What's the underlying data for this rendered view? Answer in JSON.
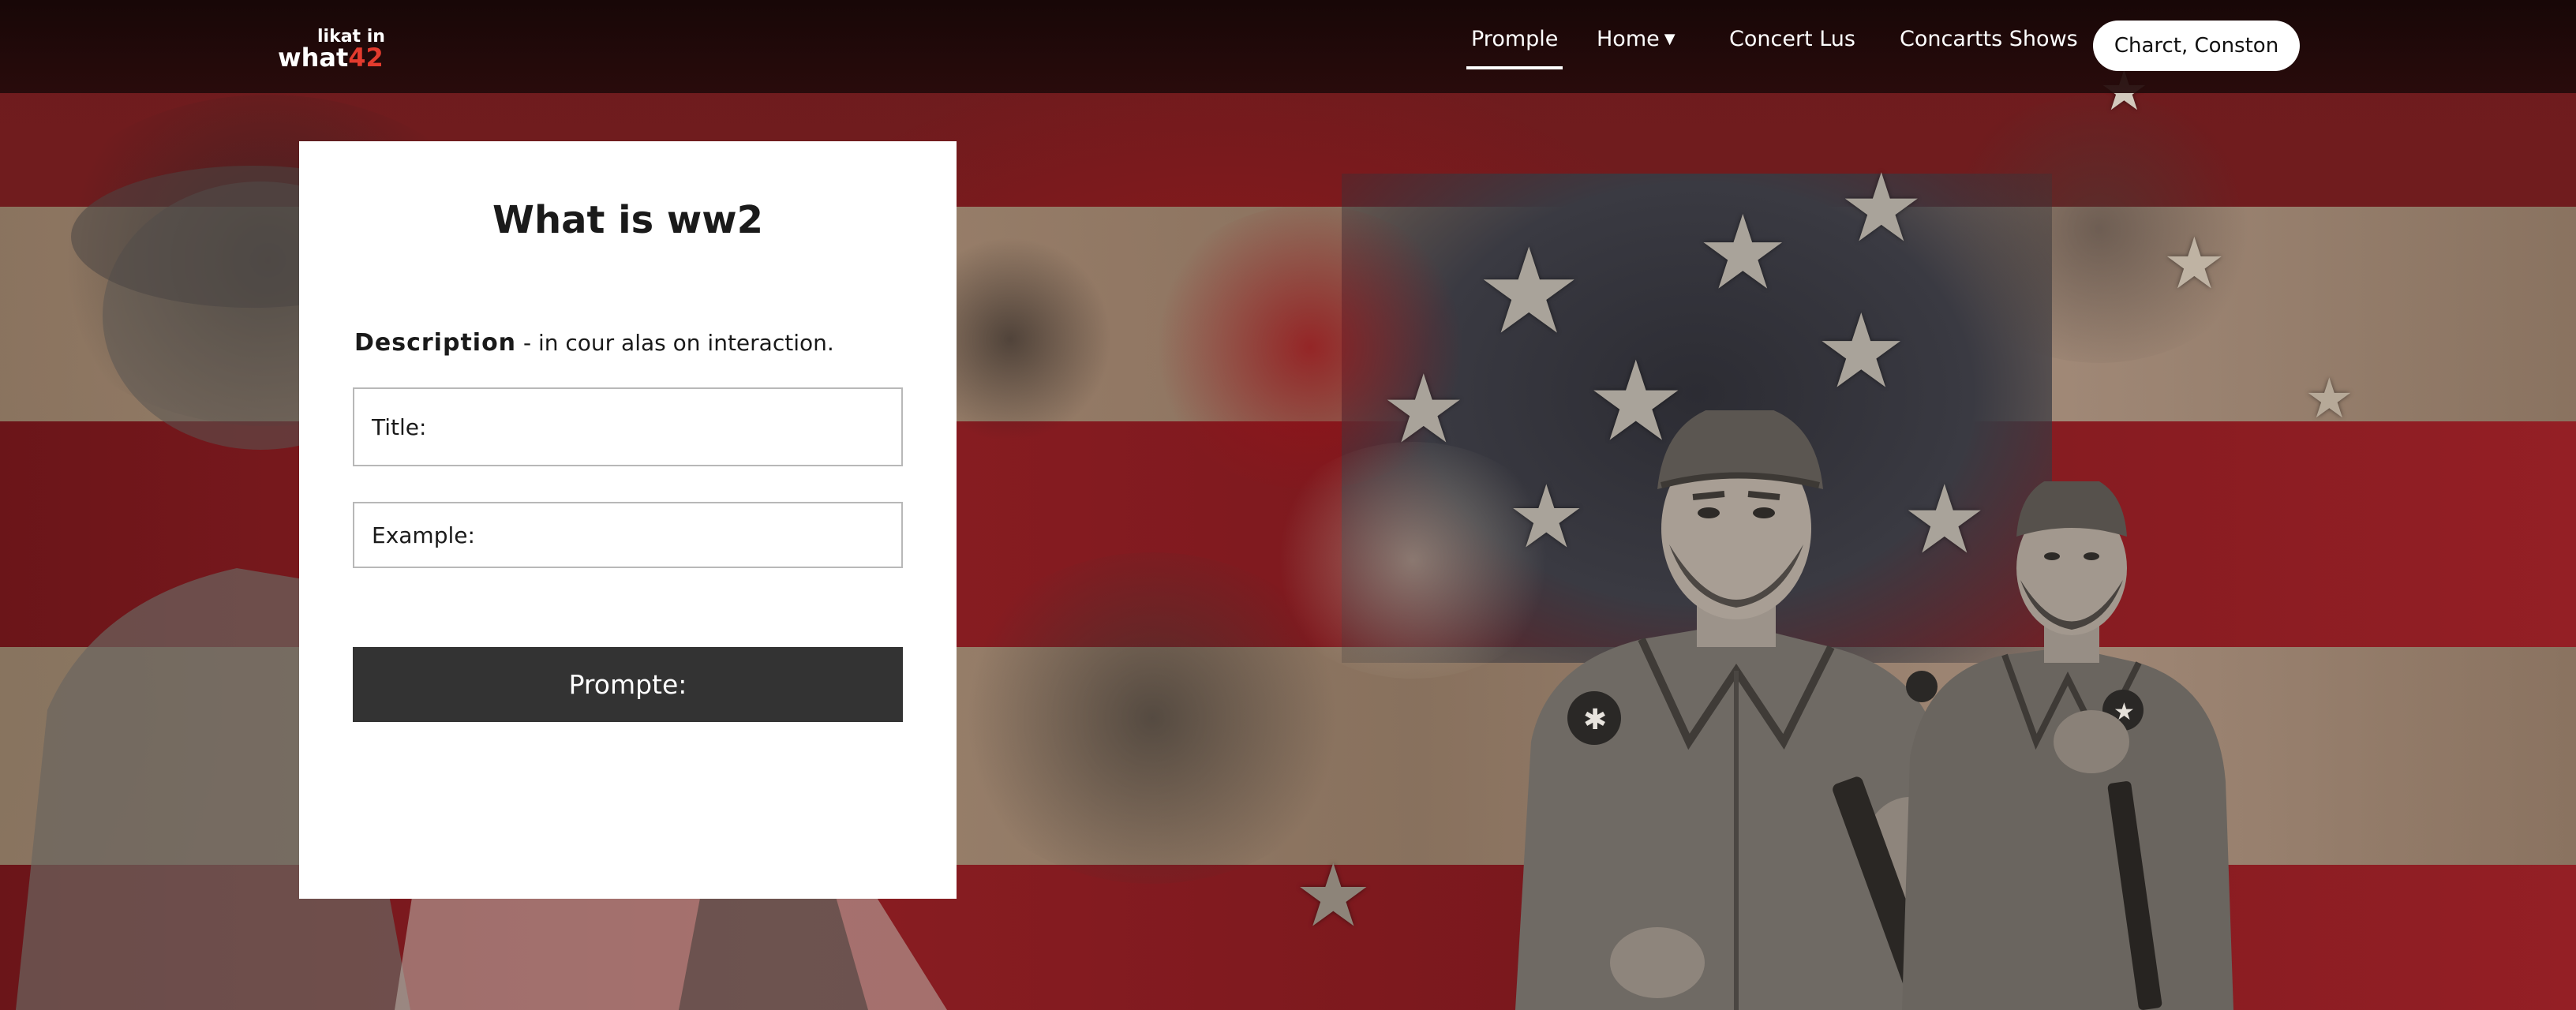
{
  "logo": {
    "line1": "likat in",
    "line2_text": "what",
    "line2_number": "42",
    "accent": "#e23b2e"
  },
  "nav": {
    "items": [
      {
        "label": "Promple",
        "active": true
      },
      {
        "label": "Home",
        "has_dropdown": true,
        "dropdown_icon": "caret-down-icon"
      },
      {
        "label": "Concert Lus"
      },
      {
        "label": "Concartts Shows"
      }
    ],
    "cta_label": "Charct, Conston"
  },
  "card": {
    "title": "What is ww2",
    "description_label": "Description",
    "description_text": " - in cour alas on interaction.",
    "fields": [
      {
        "label": "Title:"
      },
      {
        "label": "Example:"
      }
    ],
    "submit_label": "Prompte:"
  },
  "theme": {
    "navbar_bg": "#1a0707",
    "card_bg": "#ffffff",
    "button_bg": "#333333",
    "flag_red": "#8a1d22",
    "flag_tan": "#a39179",
    "canton": "#2c2c33"
  },
  "background": {
    "image_description_icon": "wwii-soldiers-distressed-flag-illustration"
  }
}
